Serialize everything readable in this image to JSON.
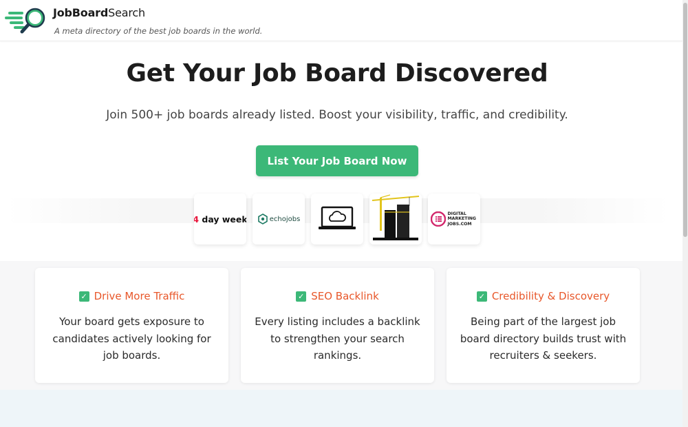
{
  "header": {
    "brand_bold": "JobBoard",
    "brand_light": "Search",
    "tagline": "A meta directory of the best job boards in the world."
  },
  "hero": {
    "title": "Get Your Job Board Discovered",
    "subtitle": "Join 500+ job boards already listed. Boost your visibility, traffic, and credibility.",
    "cta_label": "List Your Job Board Now"
  },
  "logos": [
    {
      "name": "4 day week",
      "accent": "4"
    },
    {
      "name": "echojobs"
    },
    {
      "name": "cloud-laptop"
    },
    {
      "name": "construction-crane"
    },
    {
      "name": "DIGITAL MARKETING JOBS.COM"
    }
  ],
  "features": [
    {
      "title": "Drive More Traffic",
      "body": "Your board gets exposure to candidates actively looking for job boards."
    },
    {
      "title": "SEO Backlink",
      "body": "Every listing includes a backlink to strengthen your search rankings."
    },
    {
      "title": "Credibility & Discovery",
      "body": "Being part of the largest job board directory builds trust with recruiters & seekers."
    }
  ],
  "colors": {
    "accent_green": "#3cb878",
    "feature_title": "#e8572a",
    "brand_red": "#e8173d"
  },
  "icons": {
    "check": "✓"
  }
}
